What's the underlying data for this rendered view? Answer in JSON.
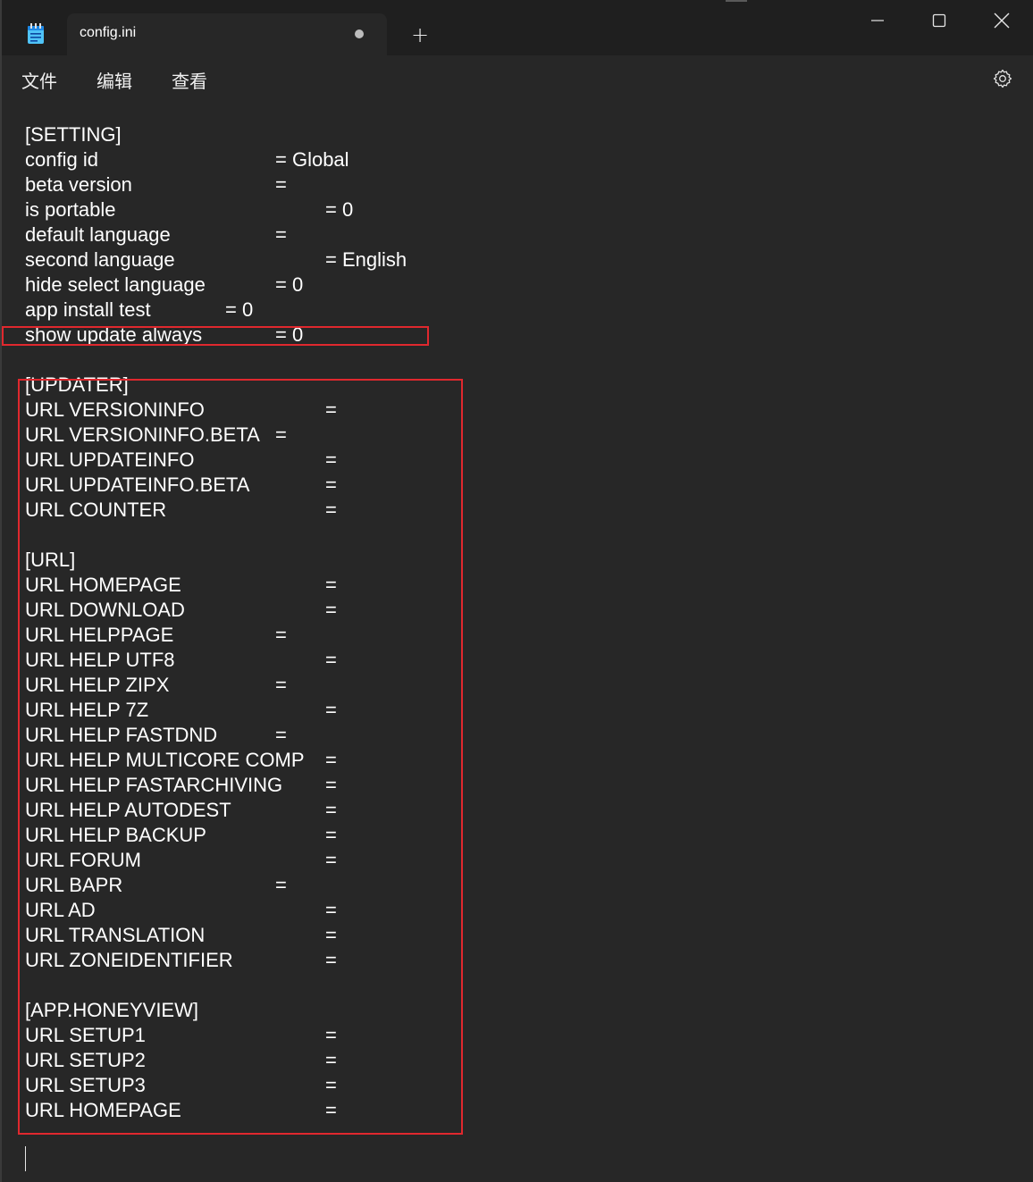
{
  "window": {
    "tab_title": "config.ini",
    "new_tab_label": "+",
    "unsaved_indicator": "unsaved-dot",
    "controls": [
      "minimize-icon",
      "maximize-icon",
      "close-icon"
    ]
  },
  "menu": {
    "items": [
      {
        "label": "文件"
      },
      {
        "label": "编辑"
      },
      {
        "label": "查看"
      }
    ],
    "settings_icon": "gear-icon"
  },
  "colors": {
    "background": "#272727",
    "titlebar": "#1f1f1f",
    "text": "#ffffff",
    "highlight_box": "#e0282e"
  },
  "document": {
    "lines": [
      {
        "key": "[SETTING]",
        "value": ""
      },
      {
        "key": "config id",
        "value": "= Global"
      },
      {
        "key": "beta version",
        "value": "="
      },
      {
        "key": "is portable",
        "value": "= 0"
      },
      {
        "key": "default language",
        "value": "="
      },
      {
        "key": "second language",
        "value": "= English"
      },
      {
        "key": "hide select language",
        "value": "= 0"
      },
      {
        "key": "app install test",
        "value": "= 0"
      },
      {
        "key": "show update always",
        "value": "= 0"
      },
      {
        "key": "",
        "value": ""
      },
      {
        "key": "[UPDATER]",
        "value": ""
      },
      {
        "key": "URL VERSIONINFO",
        "value": "="
      },
      {
        "key": "URL VERSIONINFO.BETA",
        "value": "="
      },
      {
        "key": "URL UPDATEINFO",
        "value": "="
      },
      {
        "key": "URL UPDATEINFO.BETA",
        "value": "="
      },
      {
        "key": "URL COUNTER",
        "value": "="
      },
      {
        "key": "",
        "value": ""
      },
      {
        "key": "[URL]",
        "value": ""
      },
      {
        "key": "URL HOMEPAGE",
        "value": "="
      },
      {
        "key": "URL DOWNLOAD",
        "value": "="
      },
      {
        "key": "URL HELPPAGE",
        "value": "="
      },
      {
        "key": "URL HELP UTF8",
        "value": "="
      },
      {
        "key": "URL HELP ZIPX",
        "value": "="
      },
      {
        "key": "URL HELP 7Z",
        "value": "="
      },
      {
        "key": "URL HELP FASTDND",
        "value": "="
      },
      {
        "key": "URL HELP MULTICORE COMP",
        "value": "="
      },
      {
        "key": "URL HELP FASTARCHIVING",
        "value": "="
      },
      {
        "key": "URL HELP AUTODEST",
        "value": "="
      },
      {
        "key": "URL HELP BACKUP",
        "value": "="
      },
      {
        "key": "URL FORUM",
        "value": "="
      },
      {
        "key": "URL BAPR",
        "value": "="
      },
      {
        "key": "URL AD",
        "value": "="
      },
      {
        "key": "URL TRANSLATION",
        "value": "="
      },
      {
        "key": "URL ZONEIDENTIFIER",
        "value": "="
      },
      {
        "key": "",
        "value": ""
      },
      {
        "key": "[APP.HONEYVIEW]",
        "value": ""
      },
      {
        "key": "URL SETUP1",
        "value": "="
      },
      {
        "key": "URL SETUP2",
        "value": "="
      },
      {
        "key": "URL SETUP3",
        "value": "="
      },
      {
        "key": "URL HOMEPAGE",
        "value": "="
      }
    ]
  }
}
